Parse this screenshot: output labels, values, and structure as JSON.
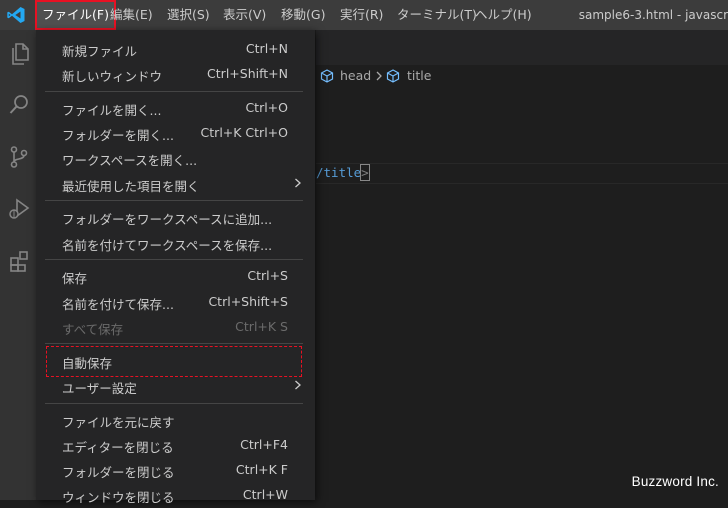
{
  "app": {
    "window_title": "sample6-3.html - javascr",
    "accent": "#e81123"
  },
  "menubar": {
    "items": [
      {
        "label": "ファイル(F)"
      },
      {
        "label": "編集(E)"
      },
      {
        "label": "選択(S)"
      },
      {
        "label": "表示(V)"
      },
      {
        "label": "移動(G)"
      },
      {
        "label": "実行(R)"
      },
      {
        "label": "ターミナル(T)"
      },
      {
        "label": "ヘルプ(H)"
      }
    ]
  },
  "activitybar": {
    "icons": [
      "files-icon",
      "search-icon",
      "source-control-icon",
      "run-debug-icon",
      "extensions-icon"
    ]
  },
  "breadcrumb": {
    "items": [
      {
        "label": "head",
        "icon": "symbol-field-icon"
      },
      {
        "label": "title",
        "icon": "symbol-field-icon"
      }
    ]
  },
  "code": {
    "visible_fragment": "/title",
    "close_bracket": ">"
  },
  "file_menu": {
    "items": [
      {
        "label": "新規ファイル",
        "shortcut": "Ctrl+N"
      },
      {
        "label": "新しいウィンドウ",
        "shortcut": "Ctrl+Shift+N"
      },
      {
        "label": "ファイルを開く...",
        "shortcut": "Ctrl+O"
      },
      {
        "label": "フォルダーを開く...",
        "shortcut": "Ctrl+K Ctrl+O"
      },
      {
        "label": "ワークスペースを開く...",
        "shortcut": ""
      },
      {
        "label": "最近使用した項目を開く",
        "shortcut": "",
        "submenu": true
      },
      {
        "label": "フォルダーをワークスペースに追加...",
        "shortcut": ""
      },
      {
        "label": "名前を付けてワークスペースを保存...",
        "shortcut": ""
      },
      {
        "label": "保存",
        "shortcut": "Ctrl+S"
      },
      {
        "label": "名前を付けて保存...",
        "shortcut": "Ctrl+Shift+S"
      },
      {
        "label": "すべて保存",
        "shortcut": "Ctrl+K S",
        "disabled": true
      },
      {
        "label": "自動保存",
        "shortcut": "",
        "highlighted": true
      },
      {
        "label": "ユーザー設定",
        "shortcut": "",
        "submenu": true
      },
      {
        "label": "ファイルを元に戻す",
        "shortcut": ""
      },
      {
        "label": "エディターを閉じる",
        "shortcut": "Ctrl+F4"
      },
      {
        "label": "フォルダーを閉じる",
        "shortcut": "Ctrl+K F"
      },
      {
        "label": "ウィンドウを閉じる",
        "shortcut": "Ctrl+W"
      }
    ]
  },
  "watermark": {
    "text": "Buzzword Inc."
  }
}
